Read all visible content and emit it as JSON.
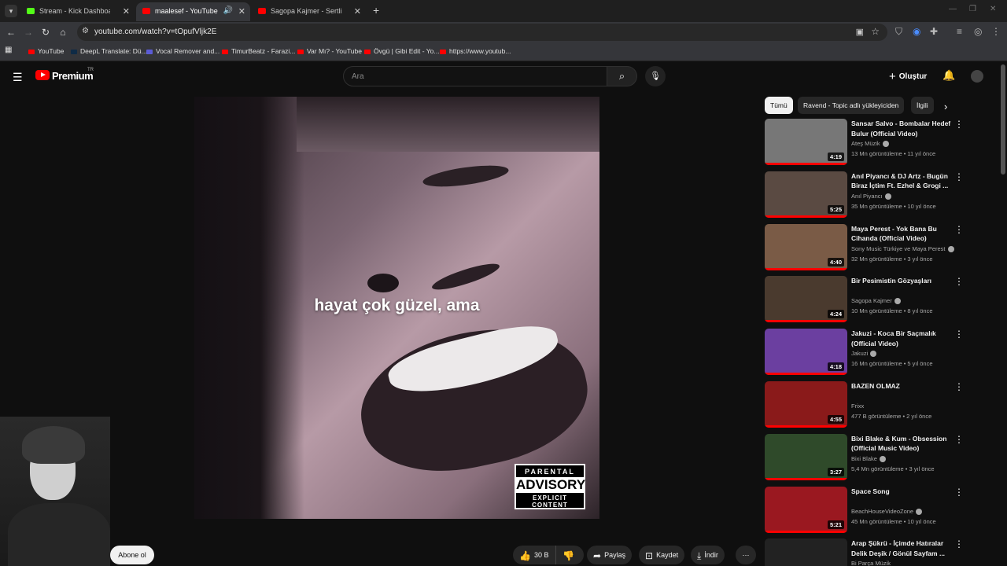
{
  "browser": {
    "tabs": [
      {
        "title": "Stream - Kick Dashboard",
        "favicon_color": "#53fc18"
      },
      {
        "title": "maalesef - YouTube",
        "favicon_color": "#ff0000"
      },
      {
        "title": "Sagopa Kajmer - Sertlik Kanındı",
        "favicon_color": "#ff0000"
      }
    ],
    "url": "youtube.com/watch?v=tOpufVljk2E",
    "bookmarks": [
      {
        "label": "YouTube"
      },
      {
        "label": "DeepL Translate: Dü..."
      },
      {
        "label": "Vocal Remover and..."
      },
      {
        "label": "TimurBeatz - Farazi..."
      },
      {
        "label": "Var Mı? - YouTube"
      },
      {
        "label": "Övgü | Gibi Edit - Yo..."
      },
      {
        "label": "https://www.youtub..."
      }
    ]
  },
  "youtube": {
    "brand": "Premium",
    "region": "TR",
    "search_placeholder": "Ara",
    "create_label": "Oluştur"
  },
  "player": {
    "subtitle": "hayat çok güzel, ama",
    "advisory": {
      "line1": "PARENTAL",
      "line2": "ADVISORY",
      "line3": "EXPLICIT CONTENT"
    }
  },
  "actions": {
    "subscribe": "Abone ol",
    "likes": "30 B",
    "share": "Paylaş",
    "save": "Kaydet",
    "download": "İndir"
  },
  "chips": [
    "Tümü",
    "Ravend - Topic adlı yükleyiciden",
    "İlgili"
  ],
  "recommendations": [
    {
      "title": "Sansar Salvo - Bombalar Hedef Bulur (Official Video)",
      "channel": "Ateş Müzik",
      "verified": true,
      "meta": "13 Mn görüntüleme • 11 yıl önce",
      "duration": "4:19",
      "music": true,
      "thumb_color": "#777777"
    },
    {
      "title": "Anıl Piyancı & DJ Artz - Bugün Biraz İçtim Ft. Ezhel & Grogi ...",
      "channel": "Anıl Piyancı",
      "verified": true,
      "meta": "35 Mn görüntüleme • 10 yıl önce",
      "duration": "5:25",
      "music": true,
      "thumb_color": "#5a4a42"
    },
    {
      "title": "Maya Perest  - Yok Bana Bu Cihanda (Official Video)",
      "channel": "Sony Music Türkiye  ve Maya Perest",
      "verified": true,
      "meta": "32 Mn görüntüleme • 3 yıl önce",
      "duration": "4:40",
      "music": true,
      "thumb_color": "#7a5b46"
    },
    {
      "title": "Bir Pesimistin Gözyaşları",
      "channel": "Sagopa Kajmer",
      "verified": true,
      "meta": "10 Mn görüntüleme • 8 yıl önce",
      "duration": "4:24",
      "music": true,
      "thumb_color": "#4a3a2e"
    },
    {
      "title": "Jakuzi - Koca Bir Saçmalık (Official Video)",
      "channel": "Jakuzi",
      "verified": true,
      "meta": "16 Mn görüntüleme • 5 yıl önce",
      "duration": "4:18",
      "music": true,
      "thumb_color": "#6b3fa0"
    },
    {
      "title": "BAZEN OLMAZ",
      "channel": "Frixx",
      "verified": false,
      "meta": "477 B görüntüleme • 2 yıl önce",
      "duration": "4:55",
      "music": false,
      "thumb_color": "#8a1a1a"
    },
    {
      "title": "Bixi Blake & Kum - Obsession (Official Music Video)",
      "channel": "Bixi Blake",
      "verified": true,
      "meta": "5,4 Mn görüntüleme • 3 yıl önce",
      "duration": "3:27",
      "music": true,
      "thumb_color": "#2f4a2a"
    },
    {
      "title": "Space Song",
      "channel": "BeachHouseVideoZone",
      "verified": true,
      "meta": "45 Mn görüntüleme • 10 yıl önce",
      "duration": "5:21",
      "music": true,
      "thumb_color": "#9a1820"
    },
    {
      "title": "Arap Şükrü - İçimde Hatıralar Delik Deşik / Gönül Sayfam ...",
      "channel": "Bi Parça Müzik",
      "verified": false,
      "meta": "",
      "duration": "",
      "music": false,
      "thumb_color": "#222222"
    }
  ]
}
